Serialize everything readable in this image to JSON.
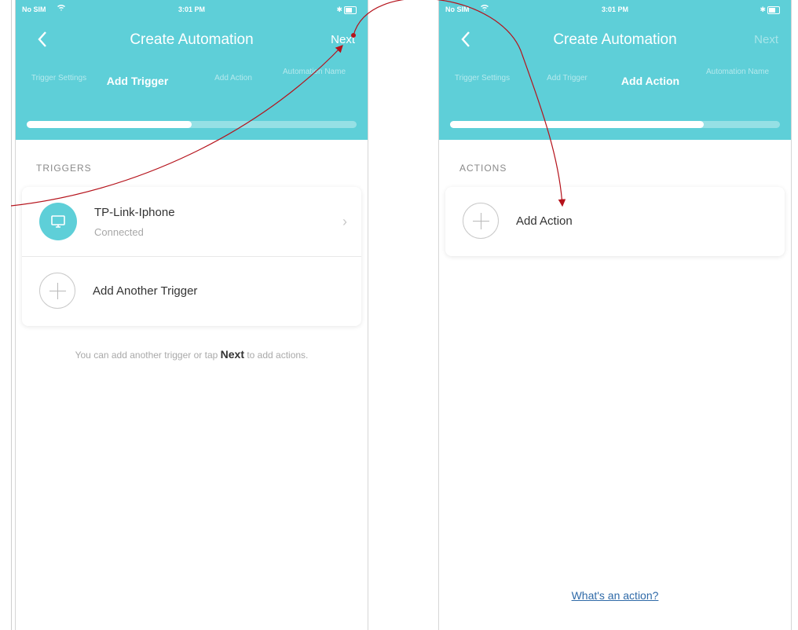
{
  "status_bar": {
    "carrier": "No SIM",
    "time": "3:01 PM",
    "battery": "✱"
  },
  "left_screen": {
    "title": "Create Automation",
    "next_label": "Next",
    "steps": [
      {
        "label": "Trigger Settings"
      },
      {
        "label": "Add Trigger"
      },
      {
        "label": "Add Action"
      },
      {
        "label": "Automation Name"
      }
    ],
    "progress": 0.5,
    "section_label": "TRIGGERS",
    "trigger": {
      "name": "TP-Link-Iphone",
      "status": "Connected"
    },
    "add_trigger_label": "Add Another Trigger",
    "hint_prefix": "You can add another trigger or tap ",
    "hint_bold": "Next",
    "hint_suffix": " to add actions."
  },
  "right_screen": {
    "title": "Create Automation",
    "next_label": "Next",
    "steps": [
      {
        "label": "Trigger Settings"
      },
      {
        "label": "Add Trigger"
      },
      {
        "label": "Add Action"
      },
      {
        "label": "Automation Name"
      }
    ],
    "progress": 0.77,
    "section_label": "ACTIONS",
    "add_action_label": "Add Action",
    "footer_link": "What's an action?"
  },
  "colors": {
    "header": "#5ecfd8",
    "annotation_arrow": "#b5121b",
    "link": "#2f6aa8"
  }
}
